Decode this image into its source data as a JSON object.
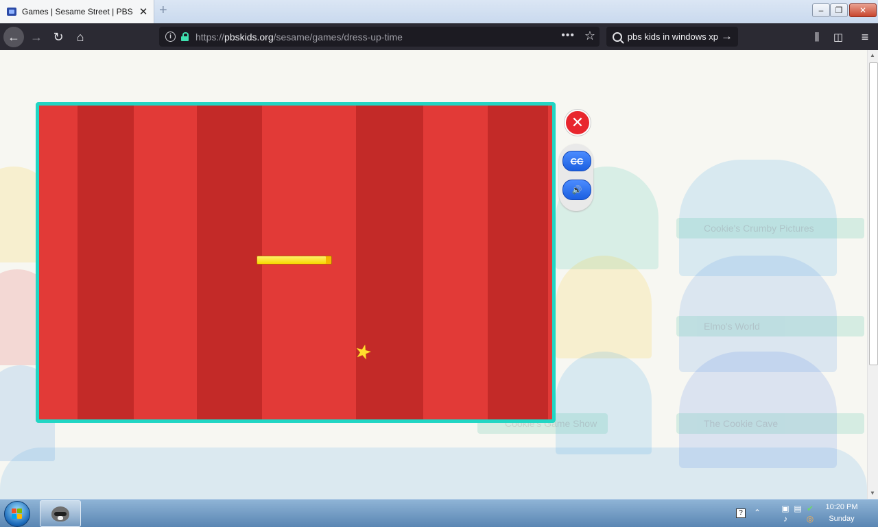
{
  "browser": {
    "tab_title": "Games | Sesame Street | PBS KIDS",
    "new_tab_symbol": "+",
    "url_prefix": "https://",
    "url_host": "pbskids.org",
    "url_path": "/sesame/games/dress-up-time",
    "page_actions": "•••",
    "search_query": "pbs kids in windows xp",
    "window_controls": {
      "minimize": "–",
      "restore": "❐",
      "close": "✕"
    }
  },
  "background": {
    "game_titles": [
      "Cookie's Crumby Pictures",
      "Elmo's World",
      "The Cookie Cave",
      "Cookie's Game Show"
    ]
  },
  "game": {
    "loading_progress": 0.93,
    "curtain_color": "#e23a37",
    "curtain_shadow_color": "#c32a28",
    "frame_color": "#22d6c4",
    "close_label": "✕",
    "cc_label": "CC",
    "sound_label": "🔊"
  },
  "taskbar": {
    "clock_time": "10:20 PM",
    "clock_day": "Sunday",
    "help_icon": "?"
  }
}
